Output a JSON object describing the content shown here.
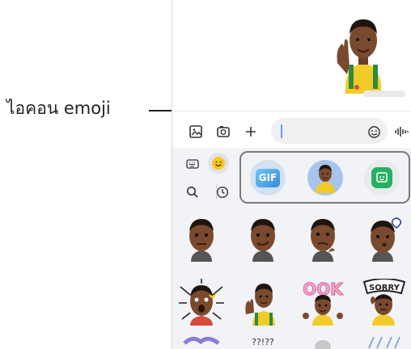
{
  "callout": {
    "label": "ไอคอน emoji"
  },
  "input": {
    "placeholder": ""
  },
  "emoji_row": {
    "gif_label": "GIF"
  },
  "stickers": [
    {
      "name": "sticker-neutral"
    },
    {
      "name": "sticker-smirk"
    },
    {
      "name": "sticker-thinking"
    },
    {
      "name": "sticker-heart-kiss"
    },
    {
      "name": "sticker-shocked"
    },
    {
      "name": "sticker-waving"
    },
    {
      "name": "sticker-ok"
    },
    {
      "name": "sticker-sorry"
    }
  ],
  "sticker_texts": {
    "ok": "OOK",
    "sorry": "SORRY",
    "partial": "??!??"
  },
  "colors": {
    "accent": "#3a8bdc",
    "sticker_green": "#25b062",
    "avatar_bg": "#a8c4ec",
    "shirt": "#f2cb2a",
    "skin": "#7a4a2e"
  }
}
